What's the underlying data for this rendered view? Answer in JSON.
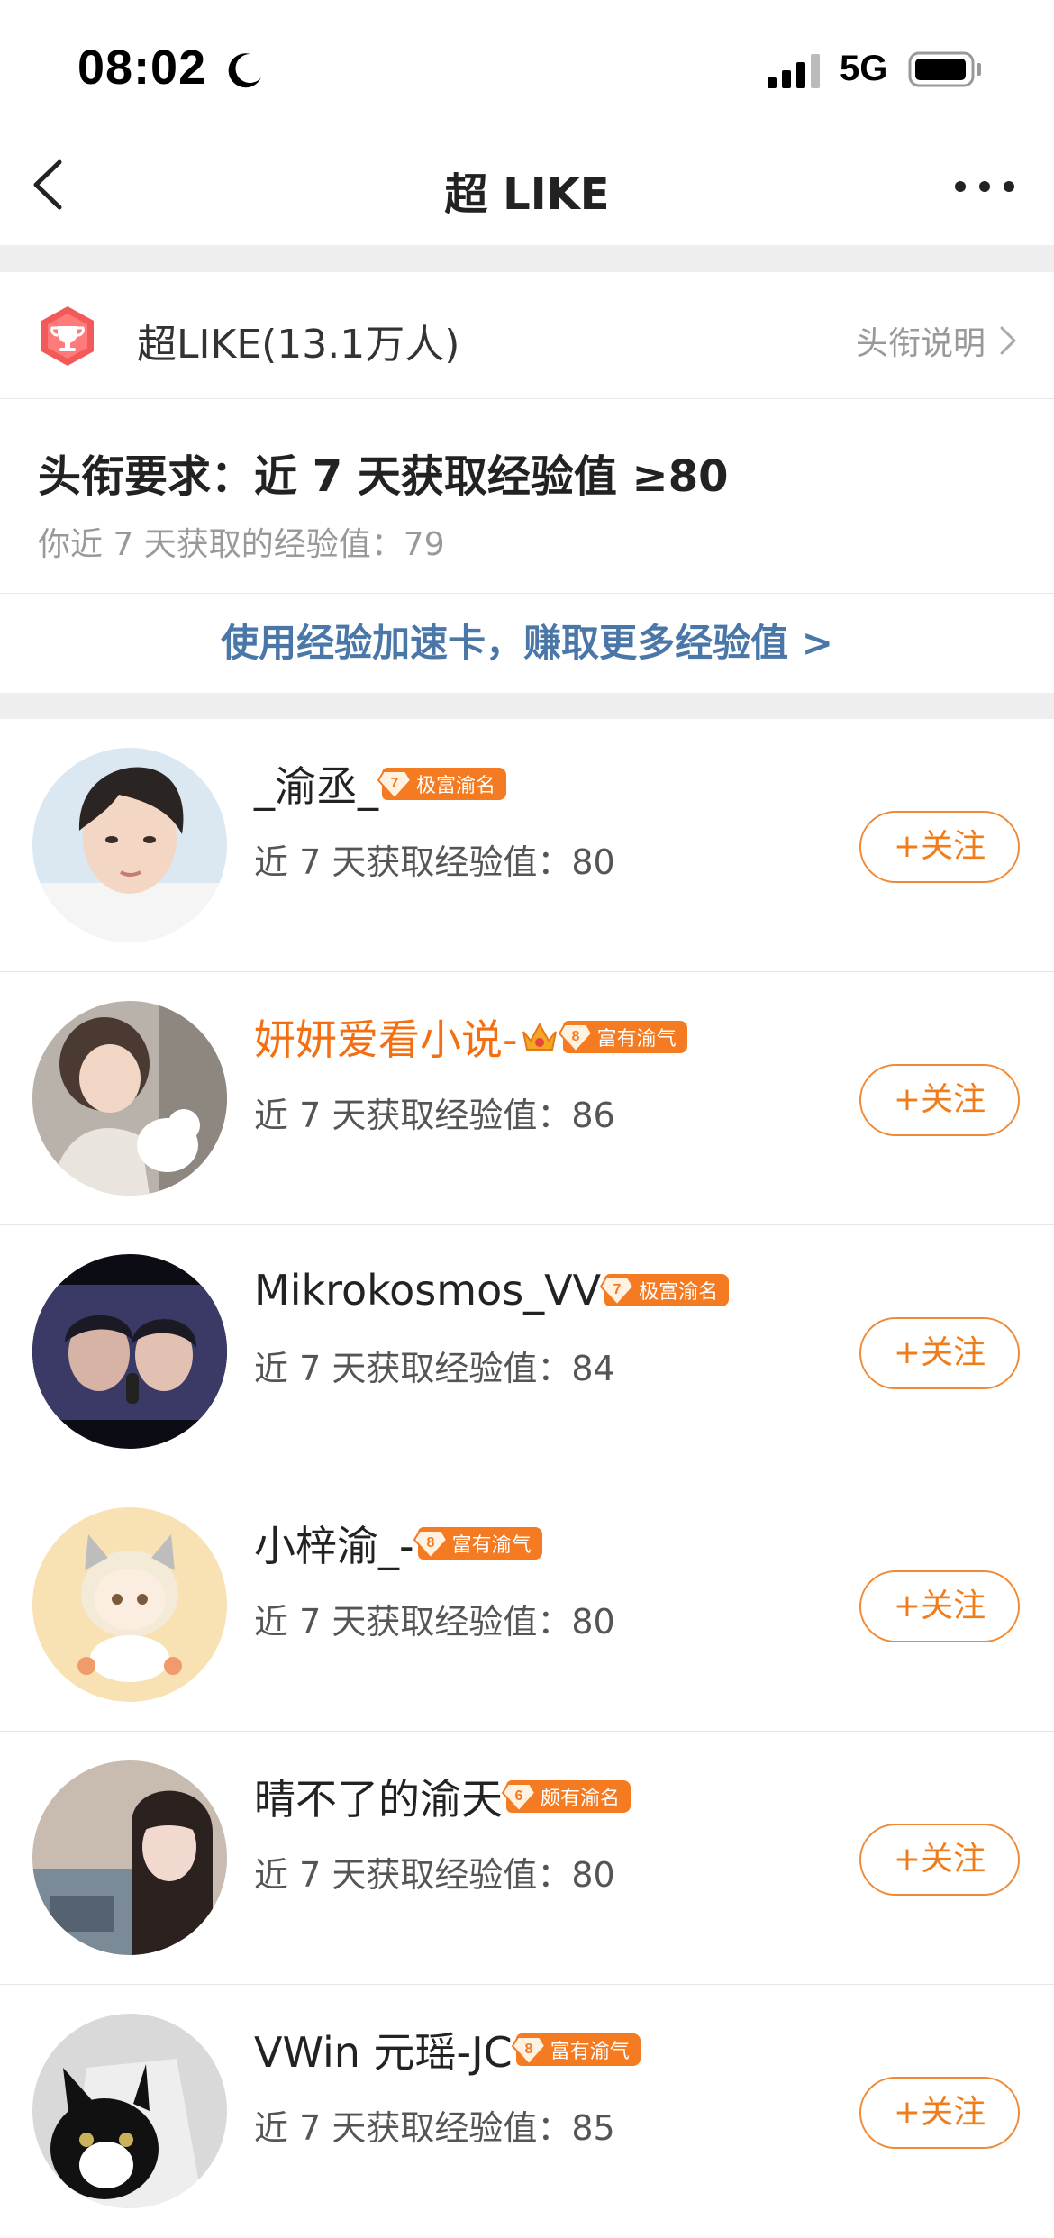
{
  "status_bar": {
    "time": "08:02",
    "network": "5G"
  },
  "nav": {
    "title": "超 LIKE"
  },
  "title_row": {
    "title": "超LIKE(13.1万人)",
    "link": "头衔说明"
  },
  "requirement": {
    "title": "头衔要求：近 7 天获取经验值 ≥80",
    "current": "你近 7 天获取的经验值：79"
  },
  "boost_link": "使用经验加速卡，赚取更多经验值 >",
  "users": [
    {
      "name": "_渝丞_",
      "vip": false,
      "crown": false,
      "level": "7",
      "level_title": "极富渝名",
      "exp": "近 7 天获取经验值：80",
      "follow": "+关注"
    },
    {
      "name": "妍妍爱看小说-",
      "vip": true,
      "crown": true,
      "level": "8",
      "level_title": "富有渝气",
      "exp": "近 7 天获取经验值：86",
      "follow": "+关注"
    },
    {
      "name": "Mikrokosmos_VV",
      "vip": false,
      "crown": false,
      "level": "7",
      "level_title": "极富渝名",
      "exp": "近 7 天获取经验值：84",
      "follow": "+关注"
    },
    {
      "name": "小梓渝_-",
      "vip": false,
      "crown": false,
      "level": "8",
      "level_title": "富有渝气",
      "exp": "近 7 天获取经验值：80",
      "follow": "+关注"
    },
    {
      "name": "晴不了的渝天",
      "vip": false,
      "crown": false,
      "level": "6",
      "level_title": "颇有渝名",
      "exp": "近 7 天获取经验值：80",
      "follow": "+关注"
    },
    {
      "name": "VWin 元瑶-JC",
      "vip": false,
      "crown": false,
      "level": "8",
      "level_title": "富有渝气",
      "exp": "近 7 天获取经验值：85",
      "follow": "+关注"
    }
  ],
  "colors": {
    "accent": "#f07d1c",
    "vip_name": "#f36f12",
    "link_blue": "#4a77a8",
    "badge_orange": "#f47b22"
  }
}
